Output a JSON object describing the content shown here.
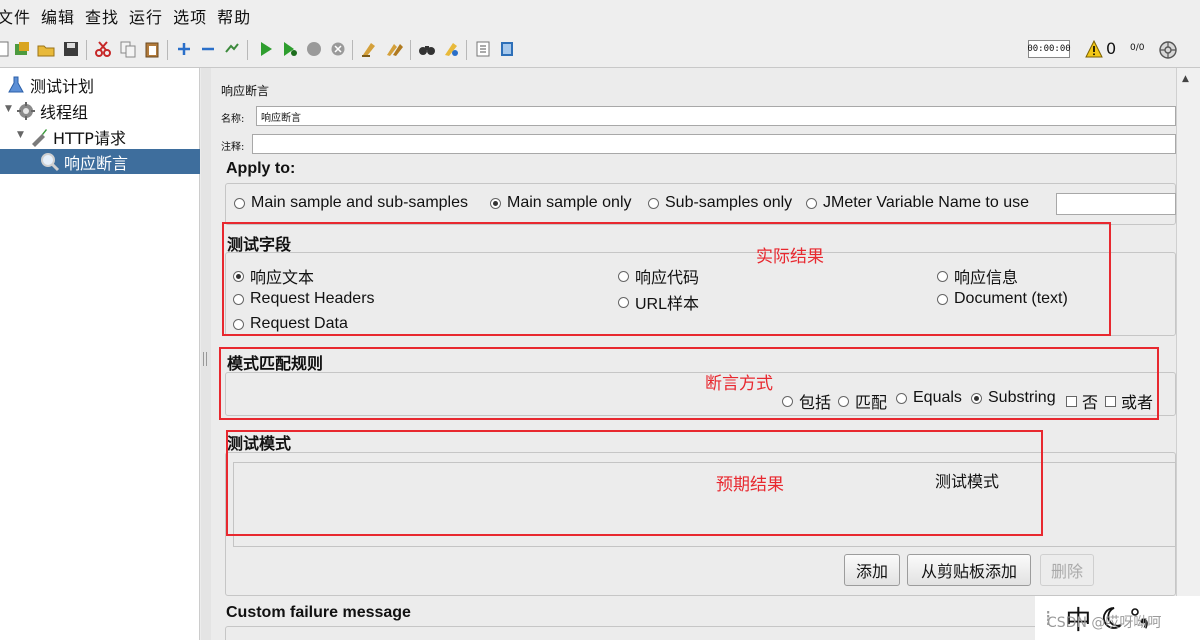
{
  "menu": [
    "文件",
    "编辑",
    "查找",
    "运行",
    "选项",
    "帮助"
  ],
  "toolbar": {
    "timer": "00:00:00",
    "warning_count": "0",
    "thread_count": "0/0",
    "icons": [
      "new-icon",
      "templates-icon",
      "open-icon",
      "save-icon",
      "cut-icon",
      "copy-icon",
      "paste-icon",
      "expand-icon",
      "collapse-icon",
      "toggle-icon",
      "start-icon",
      "start-no-pause-icon",
      "stop-icon",
      "shutdown-icon",
      "clear-icon",
      "clear-all-icon",
      "search-icon",
      "reset-search-icon",
      "function-helper-icon",
      "help-icon"
    ]
  },
  "tree": {
    "items": [
      {
        "label": "测试计划",
        "icon": "test-plan-icon"
      },
      {
        "label": "线程组",
        "icon": "thread-group-icon"
      },
      {
        "label": "HTTP请求",
        "icon": "sampler-icon"
      },
      {
        "label": "响应断言",
        "icon": "assertion-icon"
      }
    ]
  },
  "panel": {
    "title": "响应断言",
    "name_label": "名称:",
    "name_value": "响应断言",
    "comment_label": "注释:",
    "comment_value": ""
  },
  "apply_to": {
    "heading": "Apply to:",
    "options": [
      "Main sample and sub-samples",
      "Main sample only",
      "Sub-samples only",
      "JMeter Variable Name to use"
    ],
    "selected": 1,
    "variable_value": ""
  },
  "test_field": {
    "heading": "测试字段",
    "options": [
      "响应文本",
      "响应代码",
      "响应信息",
      "Request Headers",
      "URL样本",
      "Document (text)",
      "Request Data"
    ],
    "selected": 0
  },
  "pattern_rules": {
    "heading": "模式匹配规则",
    "radios": [
      "包括",
      "匹配",
      "Equals",
      "Substring"
    ],
    "selected": 3,
    "checkboxes": [
      "否",
      "或者"
    ]
  },
  "patterns": {
    "heading": "测试模式",
    "column_header": "测试模式",
    "rows": [],
    "buttons": {
      "add": "添加",
      "add_clipboard": "从剪贴板添加",
      "delete": "删除"
    }
  },
  "custom_failure": {
    "heading": "Custom failure message"
  },
  "annotations": {
    "actual": "实际结果",
    "method": "断言方式",
    "expected": "预期结果"
  },
  "overlay": {
    "ime_text": "中",
    "watermark": "CSDN @哎呀呦呵"
  },
  "colors": {
    "annotation": "#e8282f",
    "selection": "#3e6e9d"
  }
}
